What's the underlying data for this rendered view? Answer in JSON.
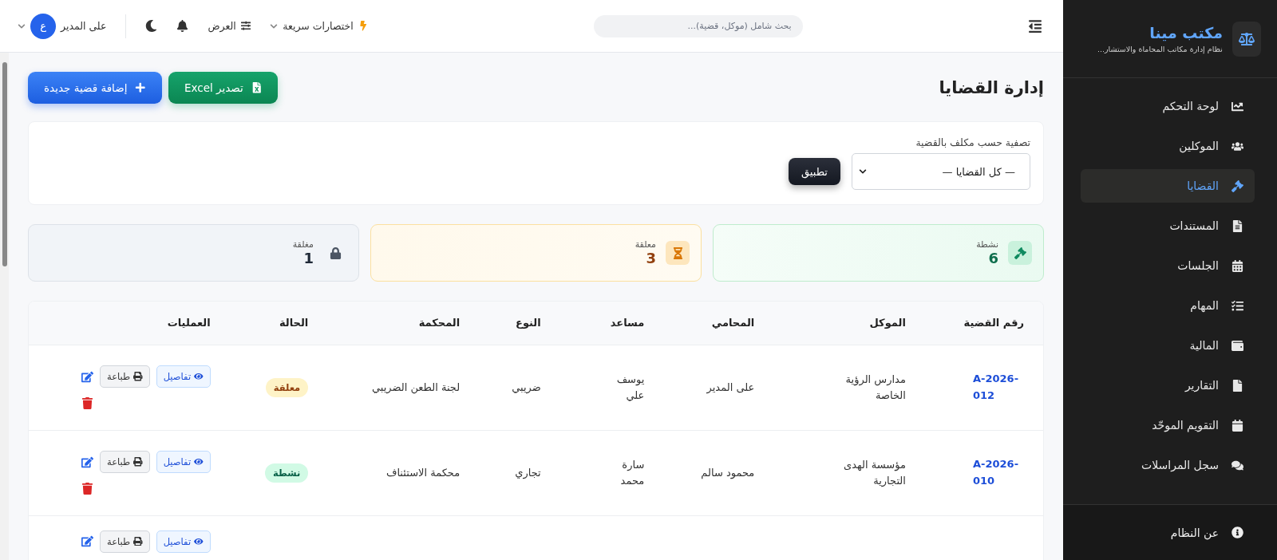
{
  "sidebar": {
    "brand": {
      "title": "مكتب مينا",
      "subtitle": "نظام إدارة مكاتب المحاماة والاستشار..."
    },
    "items": [
      {
        "label": "لوحة التحكم",
        "selected": false
      },
      {
        "label": "الموكلين",
        "selected": false
      },
      {
        "label": "القضايا",
        "selected": true
      },
      {
        "label": "المستندات",
        "selected": false
      },
      {
        "label": "الجلسات",
        "selected": false
      },
      {
        "label": "المهام",
        "selected": false
      },
      {
        "label": "المالية",
        "selected": false
      },
      {
        "label": "التقارير",
        "selected": false
      },
      {
        "label": "التقويم الموحّد",
        "selected": false
      },
      {
        "label": "سجل المراسلات",
        "selected": false
      }
    ],
    "footer": {
      "label": "عن النظام"
    }
  },
  "header": {
    "search": {
      "placeholder": "بحث شامل (موكل، قضية)..."
    },
    "shortcuts": "اختصارات سريعة",
    "view": "العرض",
    "user": {
      "name": "على المدير",
      "initial": "ع"
    }
  },
  "page": {
    "title": "إدارة القضايا",
    "actions": [
      {
        "kind": "export",
        "label": "تصدير Excel"
      },
      {
        "kind": "add",
        "label": "إضافة قضية جديدة"
      }
    ]
  },
  "filter": {
    "label": "تصفية حسب مكلف بالقضية",
    "value": "— كل القضايا —",
    "apply": "تطبيق"
  },
  "stats": [
    {
      "kind": "active",
      "label": "نشطة",
      "value": "6"
    },
    {
      "kind": "pending",
      "label": "معلقة",
      "value": "3"
    },
    {
      "kind": "closed",
      "label": "مغلقة",
      "value": "1"
    }
  ],
  "table": {
    "columns": [
      "رقم القضية",
      "الموكل",
      "المحامي",
      "مساعد",
      "النوع",
      "المحكمة",
      "الحالة",
      "العمليات"
    ],
    "rows": [
      {
        "number": "A-2026-012",
        "client": "مدارس الرؤية الخاصة",
        "lawyer": "على المدير",
        "assistant": "يوسف علي",
        "type": "ضريبي",
        "court": "لجنة الطعن الضريبي",
        "status": {
          "kind": "pending",
          "label": "معلقة"
        },
        "details": "تفاصيل",
        "print": "طباعة"
      },
      {
        "number": "A-2026-010",
        "client": "مؤسسة الهدى التجارية",
        "lawyer": "محمود سالم",
        "assistant": "سارة محمد",
        "type": "تجاري",
        "court": "محكمة الاستئناف",
        "status": {
          "kind": "active",
          "label": "نشطة"
        },
        "details": "تفاصيل",
        "print": "طباعة"
      },
      {
        "details": "تفاصيل",
        "print": "طباعة"
      }
    ]
  }
}
